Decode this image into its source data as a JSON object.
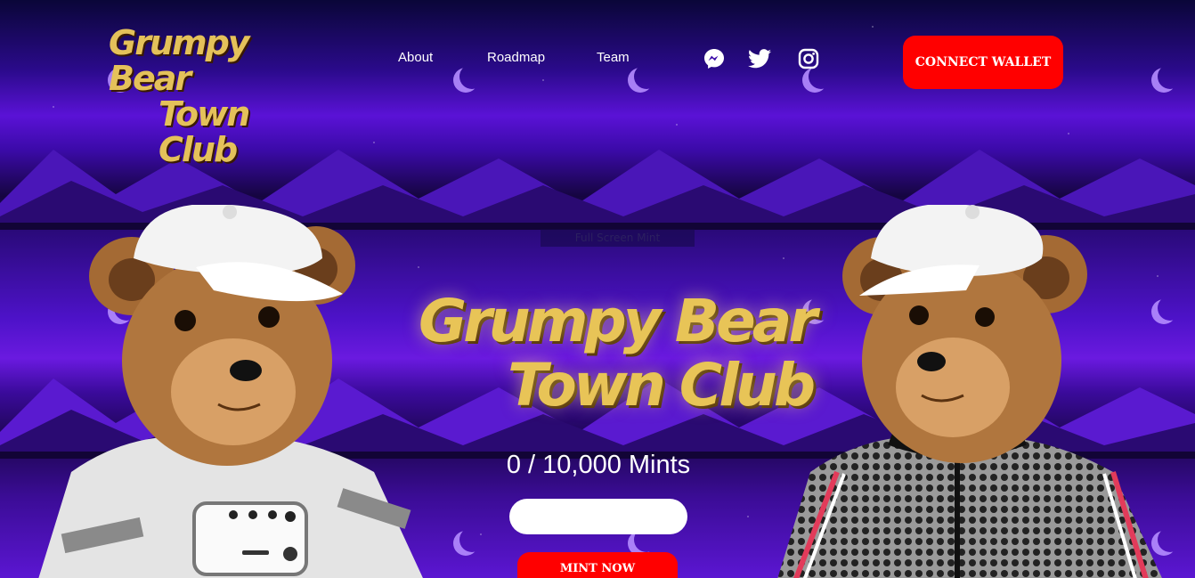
{
  "header": {
    "logo_line1": "Grumpy Bear",
    "logo_line2": "Town Club",
    "nav": [
      {
        "label": "About"
      },
      {
        "label": "Roadmap"
      },
      {
        "label": "Team"
      }
    ],
    "social_icons": [
      "messenger-icon",
      "twitter-icon",
      "instagram-icon"
    ],
    "connect_label": "CONNECT WALLET"
  },
  "hero": {
    "subnav_text": "Full Screen Mint",
    "title_line1": "Grumpy Bear",
    "title_line2": "Town Club",
    "mint_count": "0 / 10,000 Mints",
    "amount_value": "",
    "mint_label": "MINT NOW"
  },
  "colors": {
    "accent": "#ff0000",
    "logo_gold": "#e4c15a",
    "background_purple": "#4d12c8"
  }
}
